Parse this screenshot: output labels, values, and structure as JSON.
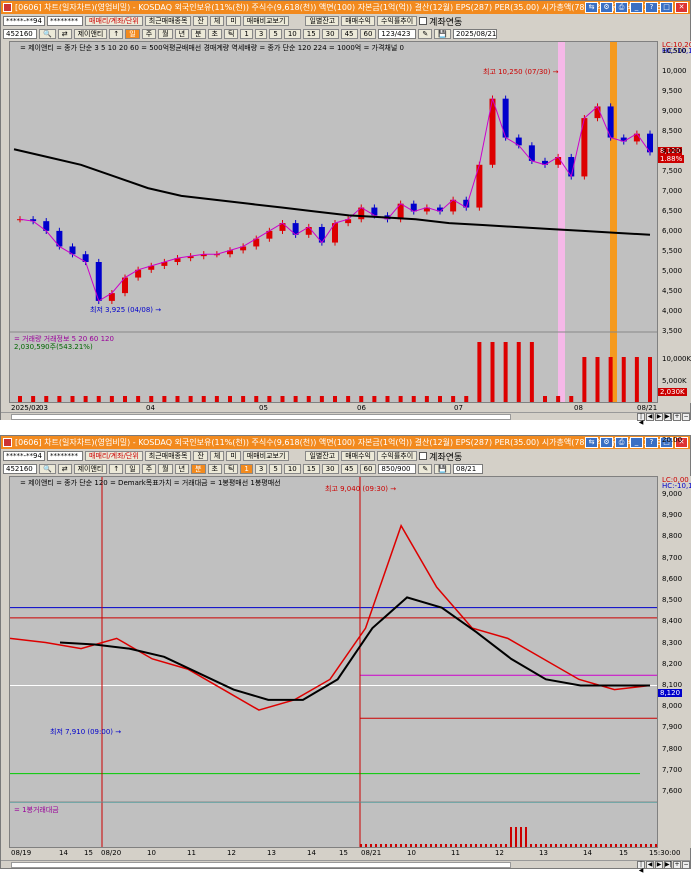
{
  "windows": [
    {
      "title": "[0606] 차트(일자차트)(영업비밀) - KOSDAQ 외국인보유(11%(천)) 주식수(9,618(천)) 액면(100) 자본금(1억(억)) 결산(12월) EPS(287) PER(35.00) 시가총액(78억(억)) 유통비율(27.8)",
      "code": "452160",
      "name": "제이앤티",
      "date": "2025/08/21",
      "count": "123/423",
      "account": "*****-**94",
      "password": "********",
      "buttons": [
        "매매리/계좌/단위",
        "최근매매종목",
        "잔",
        "체",
        "미",
        "매매비교보기",
        "일별잔고",
        "매매수익",
        "수익률추이"
      ],
      "checkbox": "계좌연동",
      "periods": [
        "주",
        "월",
        "년",
        "분",
        "초",
        "틱",
        "1",
        "3",
        "5",
        "10",
        "15",
        "30",
        "45",
        "60"
      ],
      "legend": "= 제이앤티 = 종가 단순 3  5  10  20  60  = 500억평균배매선 경매계량 역세배량 = 종가 단순 120  224 = 1000억 = 가격채널  0",
      "indicator": "= 거래량  거래정보  5  20  60  120",
      "vol_label": "2,030,590주(543.21%)",
      "high_label": "최고 10,250 (07/30) →",
      "low_label": "최저 3,925 (04/08) →",
      "price_badge": "8,120",
      "pct_badge": "1.88%",
      "yticks": [
        "10,500",
        "10,000",
        "9,500",
        "9,000",
        "8,500",
        "8,000",
        "7,500",
        "7,000",
        "6,500",
        "6,000",
        "5,500",
        "5,000",
        "4,500",
        "4,000",
        "3,500"
      ],
      "vol_ticks": [
        "10,000K",
        "5,000K"
      ],
      "vol_badge": "2,030K",
      "lc": "LC:10,20",
      "hc": "HC:-10,10",
      "xlabels": [
        "2025/02",
        "03",
        "04",
        "05",
        "06",
        "07",
        "08",
        "08/21"
      ]
    },
    {
      "title": "[0606] 차트(일자차트)(영업비밀) - KOSDAQ 외국인보유(11%(천)) 주식수(9,618(천)) 액면(100) 자본금(1억(억)) 결산(12월) EPS(287) PER(35.00) 시가총액(78억(억)) 유통비율(27.8)",
      "code": "452160",
      "name": "제이앤티",
      "date": "08/21",
      "count": "850/900",
      "account": "*****-**94",
      "password": "********",
      "buttons": [
        "매매리/계좌/단위",
        "최근매매종목",
        "잔",
        "체",
        "미",
        "매매비교보기",
        "일별잔고",
        "매매수익",
        "수익률추이"
      ],
      "checkbox": "계좌연동",
      "periods": [
        "주",
        "월",
        "년",
        "분",
        "초",
        "틱",
        "1",
        "3",
        "5",
        "10",
        "15",
        "30",
        "45",
        "60"
      ],
      "legend": "= 제이앤티 = 종가 단순 120 = Demark목표가치 = 거래대금 = 1봉평매선 1봉평매선",
      "indicator": "= 1봉거래대금",
      "high_label": "최고 9,040 (09:30) →",
      "low_label": "최저 7,910 (09:00) →",
      "price_badge": "8,120",
      "yticks": [
        "9,000",
        "8,900",
        "8,800",
        "8,700",
        "8,600",
        "8,500",
        "8,400",
        "8,300",
        "8,200",
        "8,100",
        "8,000",
        "7,900",
        "7,800",
        "7,700",
        "7,600"
      ],
      "vol_ticks": [
        "20.00"
      ],
      "lc": "LC:0,00",
      "hc": "HC:-10,10",
      "xlabels": [
        "08/19",
        "14",
        "15",
        "08/20",
        "10",
        "11",
        "12",
        "13",
        "14",
        "15",
        "08/21",
        "10",
        "11",
        "12",
        "13",
        "14",
        "15",
        "15:30:00"
      ]
    }
  ],
  "chart_data": [
    {
      "type": "candlestick",
      "title": "",
      "ylim": [
        3500,
        10700
      ],
      "x": [
        "2025/02",
        "03",
        "04",
        "05",
        "06",
        "07",
        "08",
        "08/21"
      ],
      "close": [
        6400,
        6350,
        6100,
        5700,
        5500,
        5300,
        4300,
        4500,
        4900,
        5100,
        5200,
        5300,
        5400,
        5450,
        5500,
        5500,
        5600,
        5700,
        5900,
        6100,
        6300,
        6000,
        6200,
        5800,
        6300,
        6400,
        6700,
        6500,
        6400,
        6800,
        6600,
        6700,
        6600,
        6900,
        6700,
        7800,
        9500,
        8500,
        8300,
        7900,
        7800,
        8000,
        7500,
        9000,
        9300,
        8500,
        8400,
        8600,
        8120
      ],
      "ma_black": [
        8200,
        8000,
        7800,
        7500,
        7200,
        7000,
        6900,
        6800,
        6700,
        6600,
        6500,
        6450,
        6400,
        6300,
        6250,
        6200,
        6150,
        6100,
        6050,
        6000
      ],
      "high": 10250,
      "low": 3925
    },
    {
      "type": "line",
      "title": "",
      "ylim": [
        7600,
        9050
      ],
      "x": [
        "08/19",
        "08/20",
        "08/21"
      ],
      "price": [
        8350,
        8330,
        8300,
        8350,
        8250,
        8200,
        8100,
        8000,
        8050,
        8150,
        8400,
        8900,
        8600,
        8400,
        8350,
        8250,
        8150,
        8100,
        8120
      ],
      "ma": [
        8330,
        8320,
        8300,
        8260,
        8180,
        8100,
        8050,
        8050,
        8150,
        8400,
        8550,
        8500,
        8380,
        8250,
        8150,
        8120,
        8120,
        8120
      ],
      "high": 9040,
      "low": 7910,
      "hlines": [
        8500,
        8450,
        8170,
        8120,
        7960,
        7690,
        7550
      ]
    }
  ]
}
